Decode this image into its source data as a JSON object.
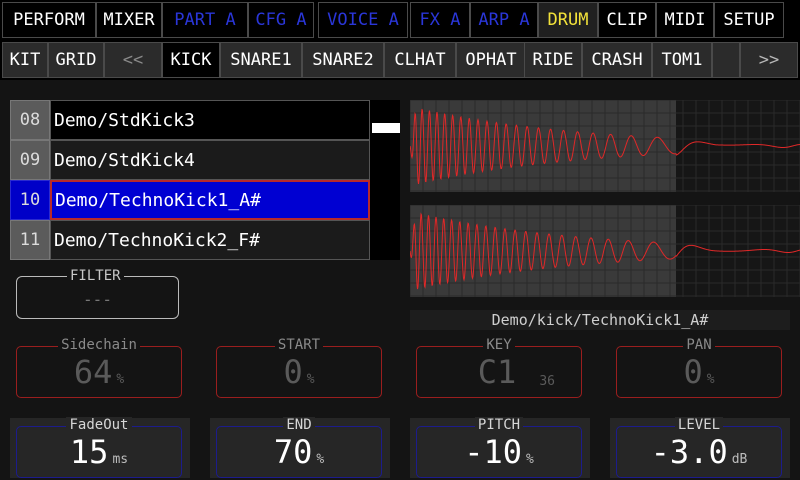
{
  "top_tabs": [
    {
      "label": "PERFORM",
      "state": "normal"
    },
    {
      "label": "MIXER",
      "state": "normal"
    },
    {
      "label": "PART A",
      "state": "part"
    },
    {
      "label": "CFG A",
      "state": "part"
    },
    {
      "label": "VOICE A",
      "state": "part"
    },
    {
      "label": "FX A",
      "state": "part"
    },
    {
      "label": "ARP A",
      "state": "part"
    },
    {
      "label": "DRUM",
      "state": "active"
    },
    {
      "label": "CLIP",
      "state": "normal"
    },
    {
      "label": "MIDI",
      "state": "normal"
    },
    {
      "label": "SETUP",
      "state": "normal"
    }
  ],
  "sub_tabs": [
    {
      "label": "KIT",
      "state": "normal"
    },
    {
      "label": "GRID",
      "state": "normal"
    },
    {
      "label": "<<",
      "state": "nav-dim"
    },
    {
      "label": "KICK",
      "state": "active"
    },
    {
      "label": "SNARE1",
      "state": "normal"
    },
    {
      "label": "SNARE2",
      "state": "normal"
    },
    {
      "label": "CLHAT",
      "state": "normal"
    },
    {
      "label": "OPHAT",
      "state": "normal"
    },
    {
      "label": "RIDE",
      "state": "normal"
    },
    {
      "label": "CRASH",
      "state": "normal"
    },
    {
      "label": "TOM1",
      "state": "normal"
    },
    {
      "label": "",
      "state": "normal"
    },
    {
      "label": ">>",
      "state": "nav"
    }
  ],
  "sample_list": [
    {
      "num": "08",
      "name": "Demo/StdKick3",
      "selected": false
    },
    {
      "num": "09",
      "name": "Demo/StdKick4",
      "selected": false
    },
    {
      "num": "10",
      "name": "Demo/TechnoKick1_A#",
      "selected": true
    },
    {
      "num": "11",
      "name": "Demo/TechnoKick2_F#",
      "selected": false
    }
  ],
  "filter": {
    "label": "FILTER",
    "value": "---"
  },
  "sample_path": "Demo/kick/TechnoKick1_A#",
  "params_row1": [
    {
      "label": "Sidechain",
      "value": "64",
      "unit": "%"
    },
    {
      "label": "START",
      "value": "0",
      "unit": "%"
    },
    {
      "label": "KEY",
      "value": "C1",
      "unit": "",
      "sub": "36"
    },
    {
      "label": "PAN",
      "value": "0",
      "unit": "%"
    }
  ],
  "params_row2": [
    {
      "label": "FadeOut",
      "value": "15",
      "unit": "ms"
    },
    {
      "label": "END",
      "value": "70",
      "unit": "%"
    },
    {
      "label": "PITCH",
      "value": "-10",
      "unit": "%"
    },
    {
      "label": "LEVEL",
      "value": "-3.0",
      "unit": "dB"
    }
  ],
  "colors": {
    "part_tab": "#2a36d8",
    "active_tab": "#f2e23a",
    "selected_row": "#0000d2",
    "waveform": "#e02828",
    "param_border_active": "#1c1c8c",
    "param_border_inactive": "#9a1e1e"
  }
}
